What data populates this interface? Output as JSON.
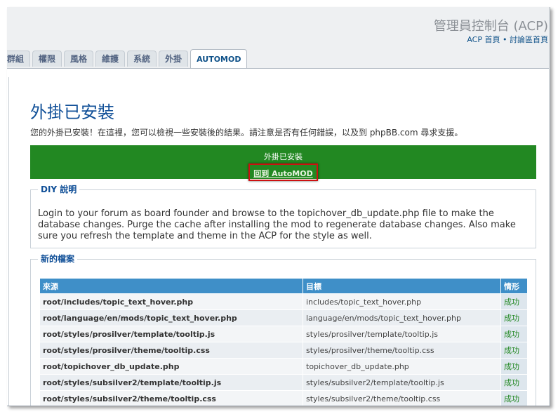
{
  "header": {
    "title": "管理員控制台 (ACP)",
    "acp_home": "ACP 首頁",
    "separator": "•",
    "forum_home": "討論區首頁"
  },
  "tabs": [
    "群組",
    "權限",
    "風格",
    "維護",
    "系統",
    "外掛",
    "AUTOMOD"
  ],
  "main": {
    "title": "外掛已安裝",
    "intro": "您的外掛已安裝！在這裡，您可以檢視一些安裝後的結果。請注意是否有任何錯誤，以及到 phpBB.com 尋求支援。"
  },
  "success_box": {
    "message": "外掛已安裝",
    "return_link": "回到 AutoMOD"
  },
  "diy": {
    "legend": "DIY 說明",
    "text": "Login to your forum as board founder and browse to the topichover_db_update.php file to make the database changes. Purge the cache after installing the mod to regenerate database changes. Also make sure you refresh the template and theme in the ACP for the style as well."
  },
  "new_files": {
    "legend": "新的檔案",
    "headers": [
      "來源",
      "目標",
      "情形"
    ],
    "rows": [
      [
        "root/includes/topic_text_hover.php",
        "includes/topic_text_hover.php",
        "成功"
      ],
      [
        "root/language/en/mods/topic_text_hover.php",
        "language/en/mods/topic_text_hover.php",
        "成功"
      ],
      [
        "root/styles/prosilver/template/tooltip.js",
        "styles/prosilver/template/tooltip.js",
        "成功"
      ],
      [
        "root/styles/prosilver/theme/tooltip.css",
        "styles/prosilver/theme/tooltip.css",
        "成功"
      ],
      [
        "root/topichover_db_update.php",
        "topichover_db_update.php",
        "成功"
      ],
      [
        "root/styles/subsilver2/template/tooltip.js",
        "styles/subsilver2/template/tooltip.js",
        "成功"
      ],
      [
        "root/styles/subsilver2/theme/tooltip.css",
        "styles/subsilver2/theme/tooltip.css",
        "成功"
      ]
    ]
  },
  "colors": {
    "accent": "#115098",
    "success_bg": "#228822",
    "table_header": "#3f8fc8",
    "highlight_border": "#cc1111"
  }
}
